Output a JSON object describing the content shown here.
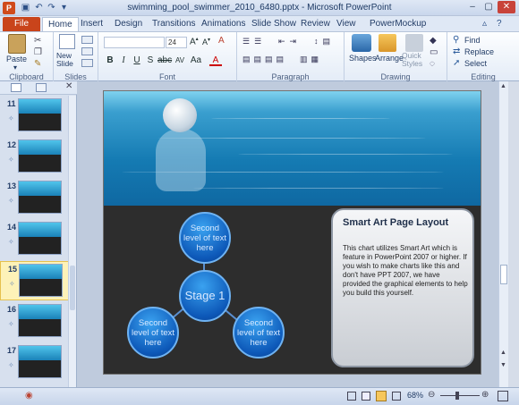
{
  "window": {
    "title": "swimming_pool_swimmer_2010_6480.pptx - Microsoft PowerPoint",
    "app_icon": "P"
  },
  "tabs": [
    "File",
    "Home",
    "Insert",
    "Design",
    "Transitions",
    "Animations",
    "Slide Show",
    "Review",
    "View",
    "PowerMockup"
  ],
  "ribbon": {
    "clipboard": {
      "label": "Clipboard",
      "paste": "Paste"
    },
    "slides": {
      "label": "Slides",
      "new_slide": "New Slide"
    },
    "font": {
      "label": "Font",
      "size": "24"
    },
    "paragraph": {
      "label": "Paragraph"
    },
    "drawing": {
      "label": "Drawing",
      "shapes": "Shapes",
      "arrange": "Arrange",
      "quick_styles": "Quick Styles"
    },
    "editing": {
      "label": "Editing",
      "find": "Find",
      "replace": "Replace",
      "select": "Select"
    }
  },
  "thumbnails": [
    {
      "num": "11"
    },
    {
      "num": "12"
    },
    {
      "num": "13"
    },
    {
      "num": "14"
    },
    {
      "num": "15",
      "selected": true
    },
    {
      "num": "16"
    },
    {
      "num": "17"
    }
  ],
  "slide": {
    "center": "Stage 1",
    "nodes": [
      "Second level of text here",
      "Second level of text here",
      "Second level of text here"
    ],
    "card_title": "Smart Art Page Layout",
    "card_body": "This chart utilizes Smart Art which is feature in PowerPoint 2007 or higher. If you wish to make charts like this and don't have PPT 2007, we have provided the graphical elements to help you build this yourself."
  },
  "status": {
    "zoom": "68%"
  },
  "colors": {
    "file_tab": "#c9441b",
    "ribbon_bg": "#e4ecf7",
    "circle": "#0d58b8"
  }
}
